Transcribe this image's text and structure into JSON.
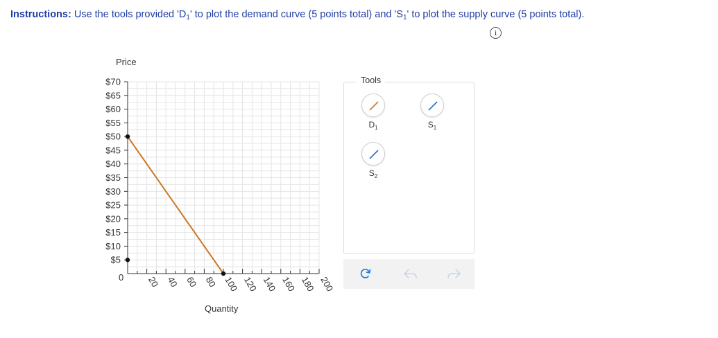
{
  "instructions": {
    "bold_label": "Instructions:",
    "text_part1": " Use the tools provided 'D",
    "d_subscript": "1",
    "text_part2": "' to plot the demand curve (5 points total) and 'S",
    "s_subscript": "1",
    "text_part3": "' to plot the supply curve (5 points total).",
    "info_icon_glyph": "i"
  },
  "chart": {
    "y_axis_title": "Price",
    "x_axis_title": "Quantity",
    "origin_label": "0",
    "y_tick_labels": [
      "$5",
      "$10",
      "$15",
      "$20",
      "$25",
      "$30",
      "$35",
      "$40",
      "$45",
      "$50",
      "$55",
      "$60",
      "$65",
      "$70"
    ],
    "x_tick_labels": [
      "20",
      "40",
      "60",
      "80",
      "100",
      "120",
      "140",
      "160",
      "180",
      "200"
    ]
  },
  "chart_data": {
    "type": "line",
    "xlabel": "Quantity",
    "ylabel": "Price",
    "xlim": [
      0,
      200
    ],
    "ylim": [
      0,
      70
    ],
    "grid": true,
    "x_ticks": [
      20,
      40,
      60,
      80,
      100,
      120,
      140,
      160,
      180,
      200
    ],
    "y_ticks": [
      5,
      10,
      15,
      20,
      25,
      30,
      35,
      40,
      45,
      50,
      55,
      60,
      65,
      70
    ],
    "series": [
      {
        "color": "#c9781f",
        "x": [
          0,
          100
        ],
        "y": [
          50,
          0
        ]
      }
    ],
    "points": [
      {
        "x": 0,
        "y": 50
      },
      {
        "x": 100,
        "y": 0
      },
      {
        "x": 0,
        "y": 5
      }
    ]
  },
  "tools": {
    "title": "Tools",
    "items": [
      {
        "letter": "D",
        "sub": "1",
        "color": "#c9781f"
      },
      {
        "letter": "S",
        "sub": "1",
        "color": "#2a6fc0"
      },
      {
        "letter": "S",
        "sub": "2",
        "color": "#2a6fc0"
      }
    ]
  },
  "actions": {
    "reset_color": "#1f7fd6",
    "disabled_color": "#c7d3e6"
  }
}
